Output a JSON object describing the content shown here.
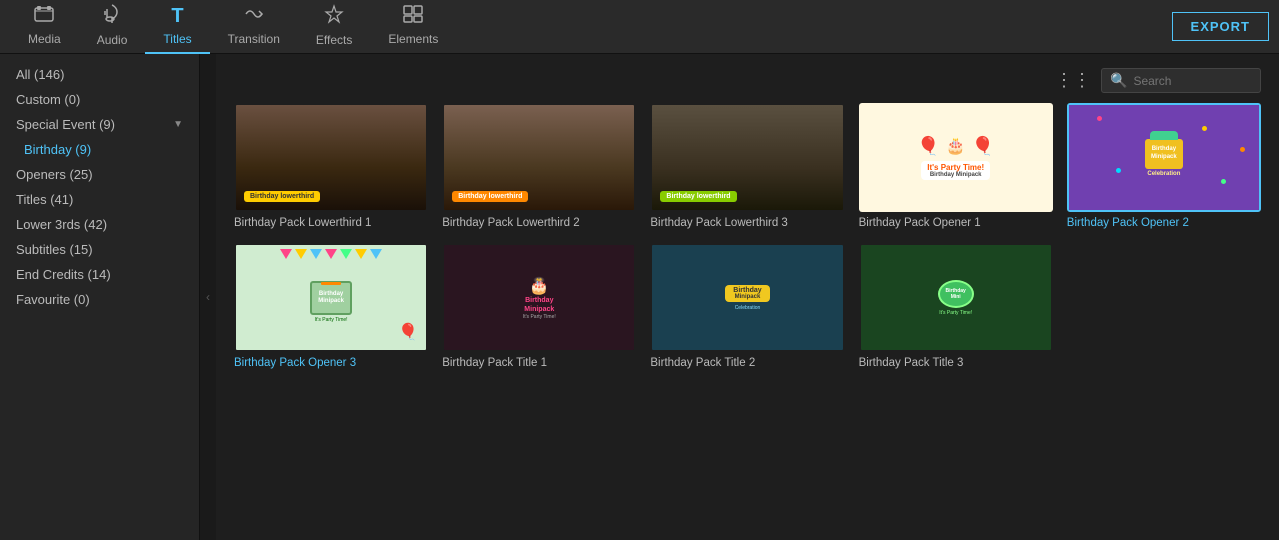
{
  "toolbar": {
    "items": [
      {
        "id": "media",
        "label": "Media",
        "icon": "🗂"
      },
      {
        "id": "audio",
        "label": "Audio",
        "icon": "♪"
      },
      {
        "id": "titles",
        "label": "Titles",
        "icon": "T"
      },
      {
        "id": "transition",
        "label": "Transition",
        "icon": "⇄"
      },
      {
        "id": "effects",
        "label": "Effects",
        "icon": "✦"
      },
      {
        "id": "elements",
        "label": "Elements",
        "icon": "🖼"
      }
    ],
    "active": "titles",
    "export_label": "EXPORT"
  },
  "sidebar": {
    "items": [
      {
        "id": "all",
        "label": "All (146)",
        "indented": false,
        "active": false
      },
      {
        "id": "custom",
        "label": "Custom (0)",
        "indented": false,
        "active": false
      },
      {
        "id": "special-event",
        "label": "Special Event (9)",
        "indented": false,
        "active": false,
        "has_arrow": true
      },
      {
        "id": "birthday",
        "label": "Birthday (9)",
        "indented": true,
        "active": true
      },
      {
        "id": "openers",
        "label": "Openers (25)",
        "indented": false,
        "active": false
      },
      {
        "id": "titles",
        "label": "Titles (41)",
        "indented": false,
        "active": false
      },
      {
        "id": "lower3rds",
        "label": "Lower 3rds (42)",
        "indented": false,
        "active": false
      },
      {
        "id": "subtitles",
        "label": "Subtitles (15)",
        "indented": false,
        "active": false
      },
      {
        "id": "end-credits",
        "label": "End Credits (14)",
        "indented": false,
        "active": false
      },
      {
        "id": "favourite",
        "label": "Favourite (0)",
        "indented": false,
        "active": false
      }
    ]
  },
  "search": {
    "placeholder": "Search"
  },
  "grid": {
    "items": [
      {
        "id": "lt1",
        "label": "Birthday Pack Lowerthird 1",
        "type": "lowerthird1"
      },
      {
        "id": "lt2",
        "label": "Birthday Pack Lowerthird 2",
        "type": "lowerthird2"
      },
      {
        "id": "lt3",
        "label": "Birthday Pack Lowerthird 3",
        "type": "lowerthird3"
      },
      {
        "id": "op1",
        "label": "Birthday Pack Opener 1",
        "type": "opener1"
      },
      {
        "id": "op2",
        "label": "Birthday Pack Opener 2",
        "type": "opener2",
        "selected": true
      },
      {
        "id": "op3",
        "label": "Birthday Pack Opener 3",
        "type": "opener3"
      },
      {
        "id": "t1",
        "label": "Birthday Pack Title 1",
        "type": "title1"
      },
      {
        "id": "t2",
        "label": "Birthday Pack Title 2",
        "type": "title2"
      },
      {
        "id": "t3",
        "label": "Birthday Pack Title 3",
        "type": "title3"
      }
    ]
  }
}
